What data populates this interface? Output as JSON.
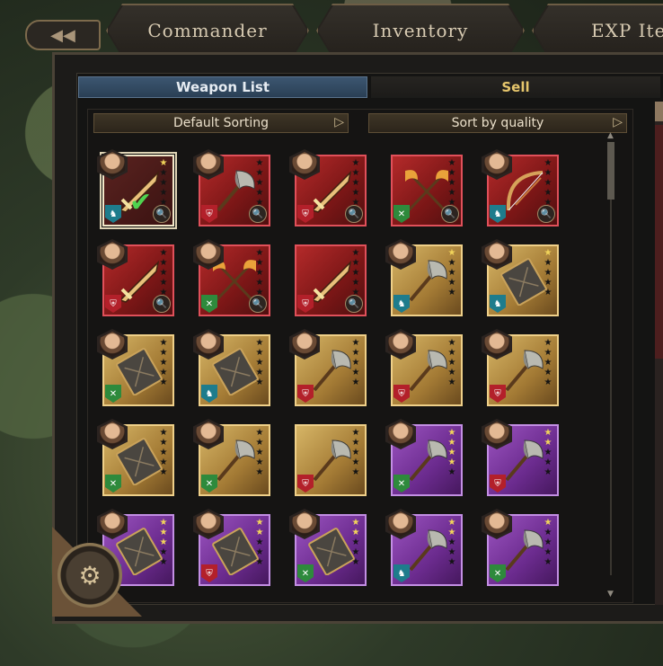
{
  "tabs": [
    "Commander",
    "Inventory",
    "EXP Iter"
  ],
  "subtabs": {
    "active": "Weapon List",
    "other": "Sell"
  },
  "sort": {
    "left": "Default Sorting",
    "right": "Sort by quality",
    "arrow": "▷"
  },
  "colors": {
    "red": "#b42a2a",
    "gold": "#d6b566",
    "purple": "#9b54c0",
    "accent_blue": "#3c5670",
    "star": "#f1d45a"
  },
  "cards": [
    {
      "quality": "red",
      "weapon": "sword",
      "badge": "cavalry",
      "stars": 1,
      "zoom": true,
      "portrait": true,
      "selected": true,
      "check": true
    },
    {
      "quality": "red",
      "weapon": "axe",
      "badge": "defense",
      "stars": 0,
      "zoom": true,
      "portrait": true
    },
    {
      "quality": "red",
      "weapon": "sword",
      "badge": "defense",
      "stars": 0,
      "zoom": true,
      "portrait": true
    },
    {
      "quality": "red",
      "weapon": "double-axe",
      "badge": "archer",
      "stars": 0,
      "zoom": true,
      "portrait": false
    },
    {
      "quality": "red",
      "weapon": "bow",
      "badge": "cavalry",
      "stars": 0,
      "zoom": true,
      "portrait": true
    },
    {
      "quality": "red",
      "weapon": "sword",
      "badge": "defense",
      "stars": 0,
      "zoom": true,
      "portrait": true
    },
    {
      "quality": "red",
      "weapon": "double-axe",
      "badge": "archer",
      "stars": 0,
      "zoom": true,
      "portrait": true
    },
    {
      "quality": "red",
      "weapon": "sword",
      "badge": "defense",
      "stars": 0,
      "zoom": true,
      "portrait": false
    },
    {
      "quality": "gold",
      "weapon": "axe",
      "badge": "cavalry",
      "stars": 1,
      "zoom": false,
      "portrait": true
    },
    {
      "quality": "gold",
      "weapon": "book",
      "badge": "cavalry",
      "stars": 1,
      "zoom": false,
      "portrait": true
    },
    {
      "quality": "gold",
      "weapon": "book",
      "badge": "archer",
      "stars": 0,
      "zoom": false,
      "portrait": true
    },
    {
      "quality": "gold",
      "weapon": "book",
      "badge": "cavalry",
      "stars": 0,
      "zoom": false,
      "portrait": true
    },
    {
      "quality": "gold",
      "weapon": "axe",
      "badge": "defense",
      "stars": 0,
      "zoom": false,
      "portrait": true
    },
    {
      "quality": "gold",
      "weapon": "axe",
      "badge": "defense",
      "stars": 0,
      "zoom": false,
      "portrait": true
    },
    {
      "quality": "gold",
      "weapon": "axe",
      "badge": "defense",
      "stars": 0,
      "zoom": false,
      "portrait": true
    },
    {
      "quality": "gold",
      "weapon": "book",
      "badge": "archer",
      "stars": 0,
      "zoom": false,
      "portrait": true
    },
    {
      "quality": "gold",
      "weapon": "axe",
      "badge": "archer",
      "stars": 0,
      "zoom": false,
      "portrait": true
    },
    {
      "quality": "gold",
      "weapon": "axe",
      "badge": "defense",
      "stars": 0,
      "zoom": false,
      "portrait": false
    },
    {
      "quality": "purple",
      "weapon": "axe",
      "badge": "archer",
      "stars": 4,
      "zoom": false,
      "portrait": true
    },
    {
      "quality": "purple",
      "weapon": "axe",
      "badge": "defense",
      "stars": 2,
      "zoom": false,
      "portrait": true
    },
    {
      "quality": "purple",
      "weapon": "book",
      "badge": "cavalry",
      "stars": 3,
      "zoom": false,
      "portrait": true
    },
    {
      "quality": "purple",
      "weapon": "book",
      "badge": "defense",
      "stars": 2,
      "zoom": false,
      "portrait": true
    },
    {
      "quality": "purple",
      "weapon": "book",
      "badge": "archer",
      "stars": 2,
      "zoom": false,
      "portrait": true
    },
    {
      "quality": "purple",
      "weapon": "axe",
      "badge": "cavalry",
      "stars": 2,
      "zoom": false,
      "portrait": true
    },
    {
      "quality": "purple",
      "weapon": "axe",
      "badge": "archer",
      "stars": 1,
      "zoom": false,
      "portrait": true
    }
  ]
}
